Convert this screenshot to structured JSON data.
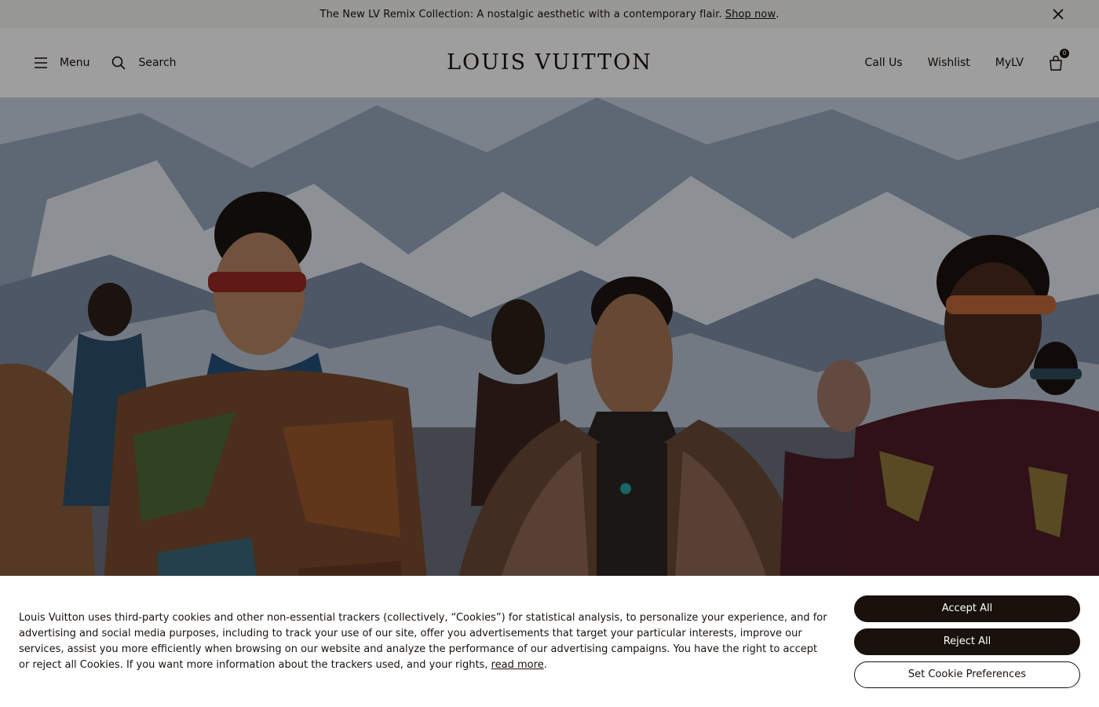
{
  "announcement": {
    "text": "The New LV Remix Collection: A nostalgic aesthetic with a contemporary flair.",
    "link": "Shop now",
    "trailing": "."
  },
  "header": {
    "menu_label": "Menu",
    "search_label": "Search",
    "logo": "LOUIS VUITTON",
    "call_us": "Call Us",
    "wishlist": "Wishlist",
    "mylv": "MyLV",
    "bag_count": "0"
  },
  "cookie_banner": {
    "text": "Louis Vuitton uses third-party cookies and other non-essential trackers (collectively, “Cookies”) for statistical analysis, to personalize your experience, and for advertising and social media purposes, including to track your use of our site, offer you advertisements that target your particular interests, improve our services, assist you more efficiently when browsing on our website and analyze the performance of our advertising campaigns. You have the right to accept or reject all Cookies. If you want more information about the trackers used, and your rights,",
    "read_more": "read more",
    "trailing": ".",
    "accept_all": "Accept All",
    "reject_all": "Reject All",
    "set_preferences": "Set Cookie Preferences"
  },
  "colors": {
    "brand_dark": "#19110b",
    "announcement_bg": "#f6f5f3"
  }
}
